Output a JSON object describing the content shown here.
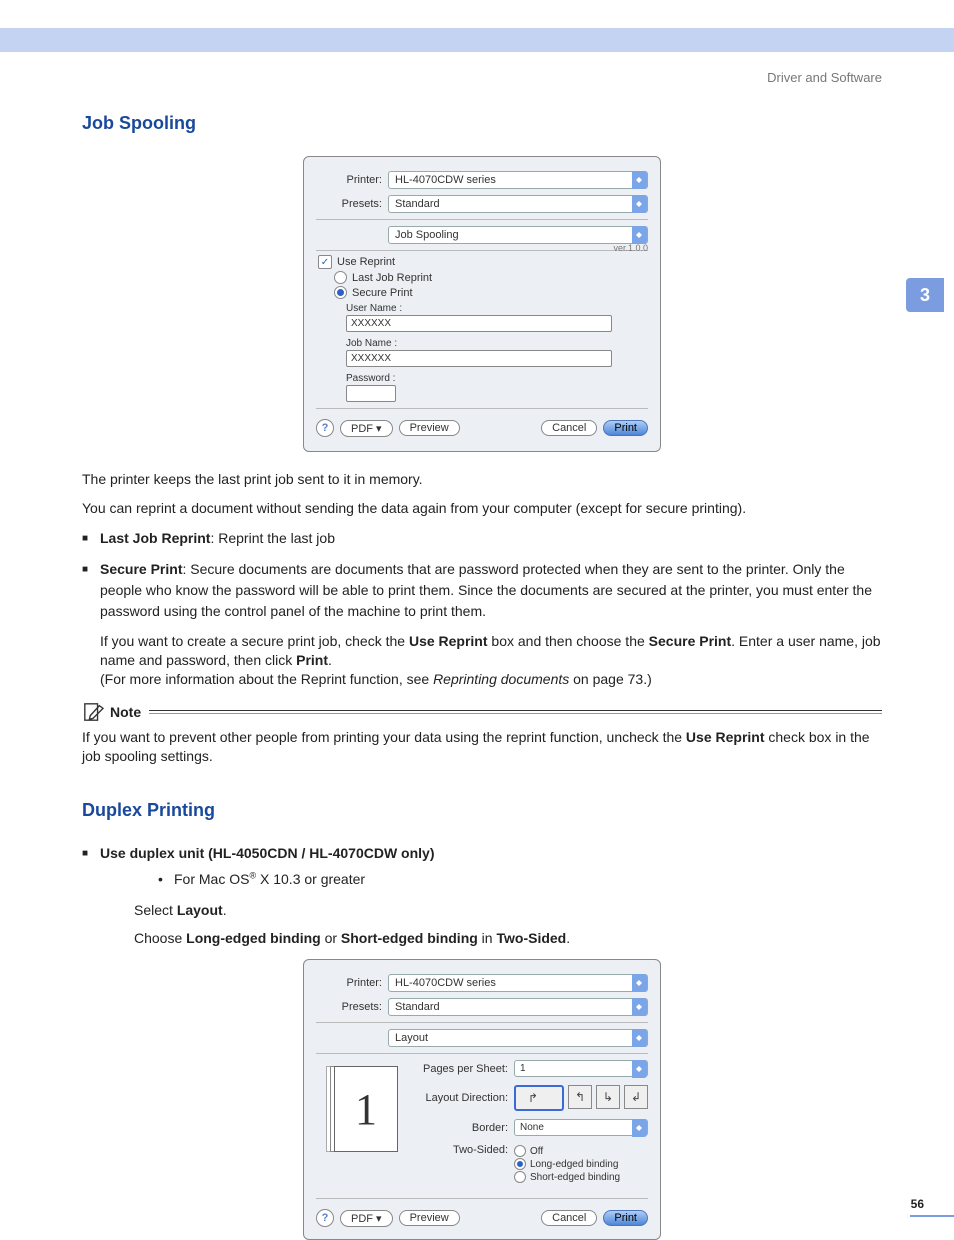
{
  "header": {
    "breadcrumb": "Driver and Software",
    "chapter_tab": "3",
    "page_number": "56"
  },
  "section1": {
    "title": "Job Spooling",
    "dialog": {
      "labels": {
        "printer": "Printer:",
        "presets": "Presets:",
        "username": "User Name :",
        "jobname": "Job Name :",
        "password": "Password :"
      },
      "printer": "HL-4070CDW series",
      "presets": "Standard",
      "pane": "Job Spooling",
      "version": "ver.1.0.0",
      "use_reprint": "Use Reprint",
      "last_job": "Last Job Reprint",
      "secure": "Secure Print",
      "username_val": "XXXXXX",
      "jobname_val": "XXXXXX",
      "pdf": "PDF ▾",
      "preview": "Preview",
      "cancel": "Cancel",
      "print": "Print"
    },
    "p1": "The printer keeps the last print job sent to it in memory.",
    "p2": "You can reprint a document without sending the data again from your computer (except for secure printing).",
    "li1_b": "Last Job Reprint",
    "li1_t": ": Reprint the last job",
    "li2_b": "Secure Print",
    "li2_t": ": Secure documents are documents that are password protected when they are sent to the printer. Only the people who know the password will be able to print them. Since the documents are secured at the printer, you must enter the password using the control panel of the machine to print them.",
    "p3a": "If you want to create a secure print job, check the ",
    "p3b": "Use Reprint",
    "p3c": " box and then choose the ",
    "p3d": "Secure Print",
    "p3e": ". Enter a user name, job name and password, then click ",
    "p3f": "Print",
    "p3g": ".",
    "p4a": "(For more information about the Reprint function, see ",
    "p4b": "Reprinting documents",
    "p4c": " on page 73.)",
    "note_label": "Note",
    "note_t1": "If you want to prevent other people from printing your data using the reprint function, uncheck the ",
    "note_b": "Use Reprint",
    "note_t2": " check box in the job spooling settings."
  },
  "section2": {
    "title": "Duplex Printing",
    "li_b": "Use duplex unit (HL-4050CDN / HL-4070CDW only)",
    "sub1a": "For Mac OS",
    "sub1b": " X 10.3 or greater",
    "l1a": "Select ",
    "l1b": "Layout",
    "l1c": ".",
    "l2a": "Choose ",
    "l2b": "Long-edged binding",
    "l2c": " or ",
    "l2d": "Short-edged binding",
    "l2e": " in ",
    "l2f": "Two-Sided",
    "l2g": ".",
    "dialog": {
      "labels": {
        "printer": "Printer:",
        "presets": "Presets:",
        "pps": "Pages per Sheet:",
        "dir": "Layout Direction:",
        "border": "Border:",
        "two": "Two-Sided:"
      },
      "printer": "HL-4070CDW series",
      "presets": "Standard",
      "pane": "Layout",
      "thumb": "1",
      "pps": "1",
      "border": "None",
      "off": "Off",
      "long": "Long-edged binding",
      "short": "Short-edged binding",
      "pdf": "PDF ▾",
      "preview": "Preview",
      "cancel": "Cancel",
      "print": "Print"
    }
  }
}
